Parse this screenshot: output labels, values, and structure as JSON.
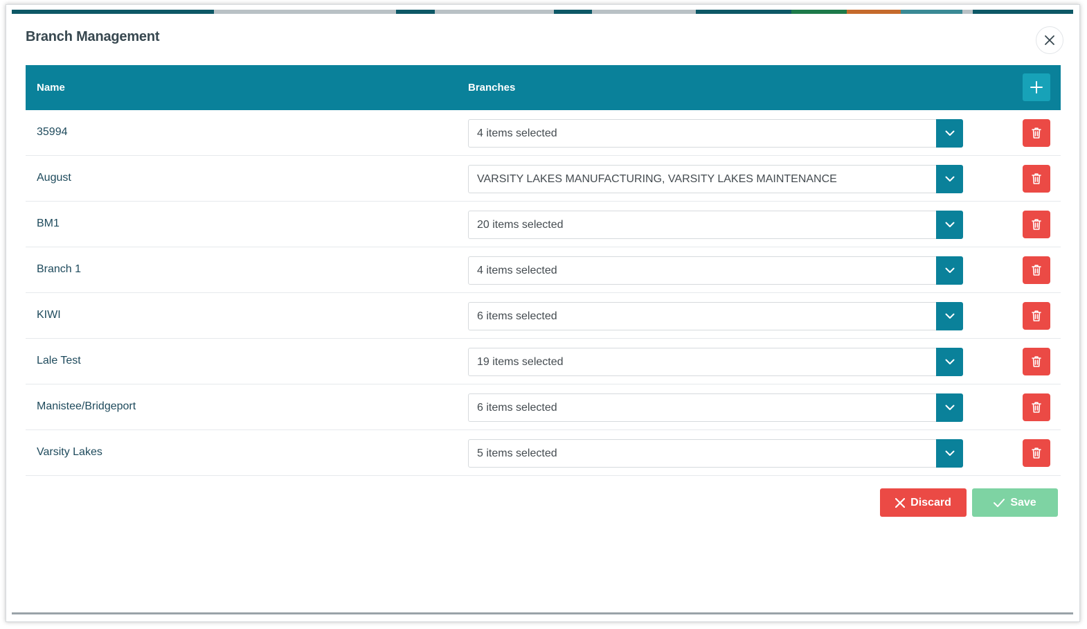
{
  "window": {
    "title": "Branch Management",
    "close_icon": "close-icon"
  },
  "colors": {
    "header_bg": "#0a819a",
    "add_button": "#17a2b8",
    "delete_button": "#eb4a45",
    "discard_button": "#eb4a45",
    "save_button_disabled": "#7ed3a3"
  },
  "table": {
    "columns": [
      "Name",
      "Branches"
    ],
    "add_icon": "plus-icon",
    "rows": [
      {
        "name": "35994",
        "branches": "4 items selected"
      },
      {
        "name": "August",
        "branches": "VARSITY LAKES MANUFACTURING, VARSITY LAKES MAINTENANCE"
      },
      {
        "name": "BM1",
        "branches": "20 items selected"
      },
      {
        "name": "Branch 1",
        "branches": "4 items selected"
      },
      {
        "name": "KIWI",
        "branches": "6 items selected"
      },
      {
        "name": "Lale Test",
        "branches": "19 items selected"
      },
      {
        "name": "Manistee/Bridgeport",
        "branches": "6 items selected"
      },
      {
        "name": "Varsity Lakes",
        "branches": "5 items selected"
      }
    ]
  },
  "footer": {
    "discard_label": "Discard",
    "save_label": "Save"
  }
}
